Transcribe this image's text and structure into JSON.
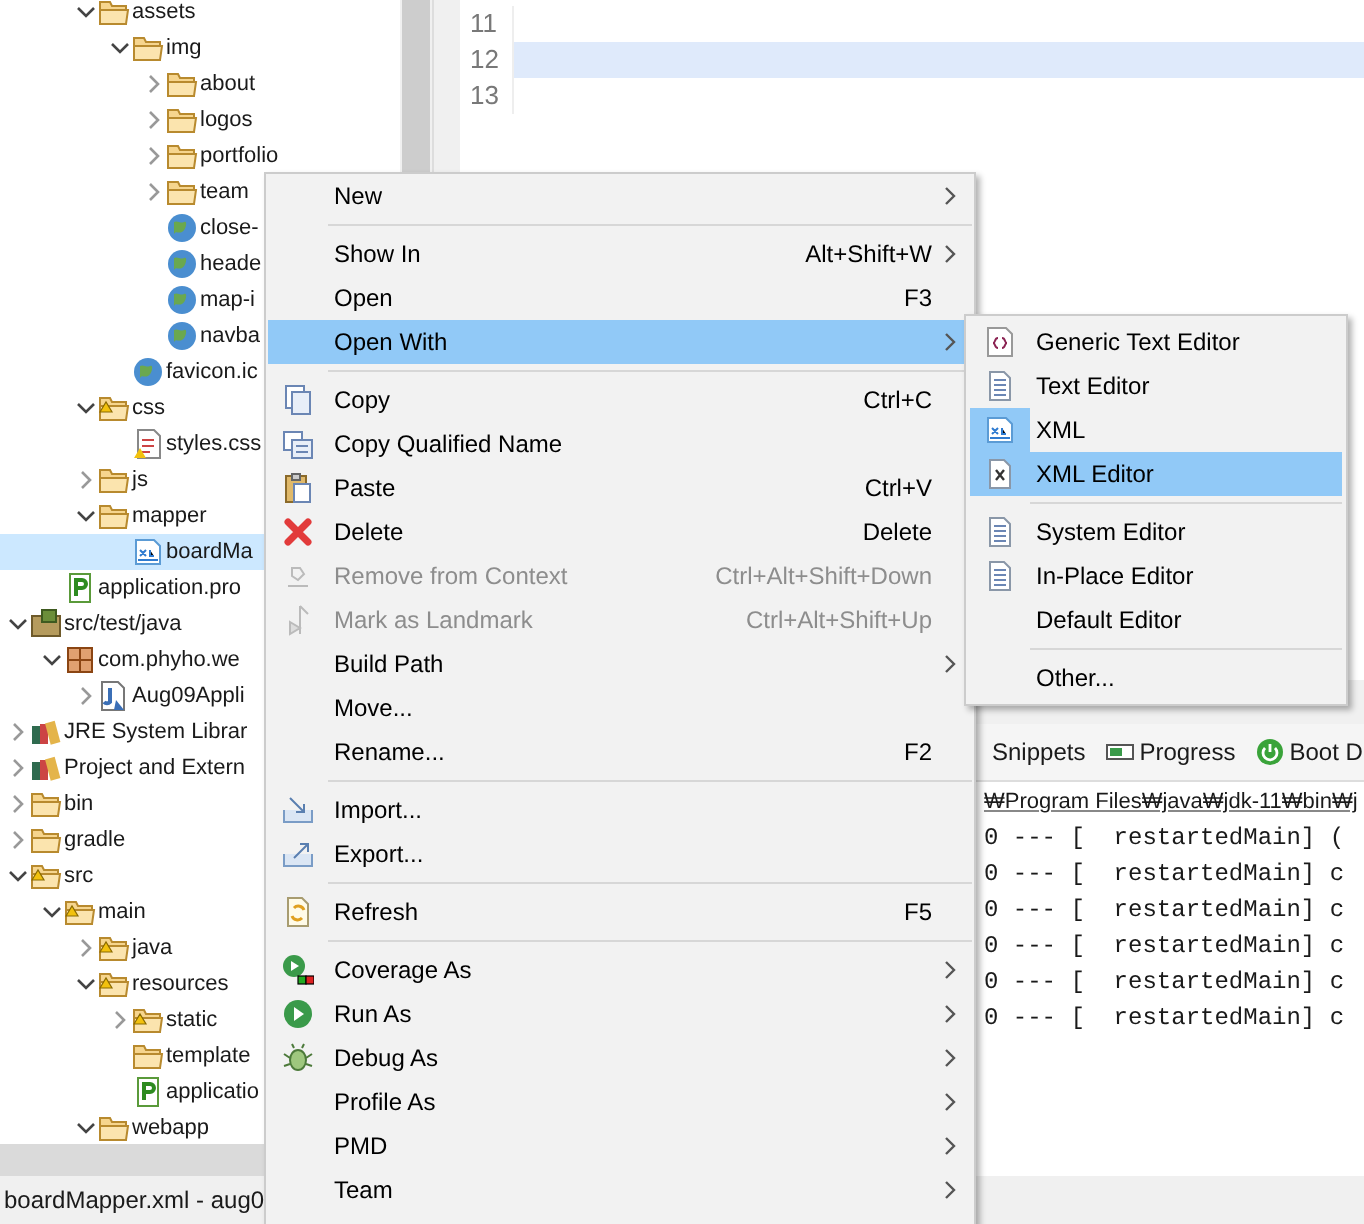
{
  "tree": {
    "items": [
      {
        "children": [
          {
            "children": [
              {
                "label": "assets",
                "kind": "folder",
                "expanded": true,
                "selected": false,
                "children": [
                  {
                    "label": "img",
                    "kind": "folder",
                    "expanded": true,
                    "selected": false,
                    "children": [
                      {
                        "label": "about",
                        "kind": "folder",
                        "expanded": false,
                        "selected": false
                      },
                      {
                        "label": "logos",
                        "kind": "folder",
                        "expanded": false,
                        "selected": false
                      },
                      {
                        "label": "portfolio",
                        "kind": "folder",
                        "expanded": false,
                        "selected": false
                      },
                      {
                        "label": "team",
                        "kind": "folder",
                        "expanded": false,
                        "selected": false
                      },
                      {
                        "label": "close-",
                        "kind": "globe",
                        "selected": false
                      },
                      {
                        "label": "heade",
                        "kind": "globe",
                        "selected": false
                      },
                      {
                        "label": "map-i",
                        "kind": "globe",
                        "selected": false
                      },
                      {
                        "label": "navba",
                        "kind": "globe",
                        "selected": false
                      }
                    ]
                  },
                  {
                    "label": "favicon.ic",
                    "kind": "globe",
                    "selected": false
                  }
                ]
              },
              {
                "label": "css",
                "kind": "folder-warn",
                "expanded": true,
                "selected": false,
                "children": [
                  {
                    "label": "styles.css",
                    "kind": "css",
                    "selected": false
                  }
                ]
              },
              {
                "label": "js",
                "kind": "folder",
                "expanded": false,
                "selected": false
              },
              {
                "label": "mapper",
                "kind": "folder",
                "expanded": true,
                "selected": false,
                "children": [
                  {
                    "label": "boardMa",
                    "kind": "xml",
                    "selected": true
                  }
                ]
              }
            ]
          },
          {
            "label": "application.pro",
            "kind": "props",
            "selected": false
          }
        ]
      },
      {
        "label": "src/test/java",
        "kind": "src-folder",
        "expanded": true,
        "selected": false,
        "children": [
          {
            "label": "com.phyho.we",
            "kind": "package",
            "expanded": true,
            "selected": false,
            "children": [
              {
                "label": "Aug09Appli",
                "kind": "java-test",
                "expanded": false,
                "selected": false
              }
            ]
          }
        ]
      },
      {
        "label": "JRE System Librar",
        "kind": "library",
        "expanded": false,
        "selected": false
      },
      {
        "label": "Project and Extern",
        "kind": "library",
        "expanded": false,
        "selected": false
      },
      {
        "label": "bin",
        "kind": "folder",
        "expanded": false,
        "selected": false
      },
      {
        "label": "gradle",
        "kind": "folder",
        "expanded": false,
        "selected": false
      },
      {
        "label": "src",
        "kind": "folder-warn",
        "expanded": true,
        "selected": false,
        "children": [
          {
            "label": "main",
            "kind": "folder-warn",
            "expanded": true,
            "selected": false,
            "children": [
              {
                "label": "java",
                "kind": "folder-warn",
                "expanded": false,
                "selected": false
              },
              {
                "label": "resources",
                "kind": "folder-warn",
                "expanded": true,
                "selected": false,
                "children": [
                  {
                    "label": "static",
                    "kind": "folder-warn",
                    "expanded": false,
                    "selected": false
                  },
                  {
                    "label": "template",
                    "kind": "folder",
                    "selected": false
                  },
                  {
                    "label": "applicatio",
                    "kind": "props",
                    "selected": false
                  }
                ]
              },
              {
                "label": "webapp",
                "kind": "folder",
                "expanded": true,
                "selected": false
              }
            ]
          }
        ]
      }
    ]
  },
  "editor": {
    "lines": [
      {
        "number": "11",
        "current": false
      },
      {
        "number": "12",
        "current": true
      },
      {
        "number": "13",
        "current": false
      }
    ]
  },
  "console": {
    "tabs": [
      {
        "label": "Snippets",
        "kind": "none"
      },
      {
        "label": "Progress",
        "kind": "progress"
      },
      {
        "label": "Boot D",
        "kind": "boot"
      }
    ],
    "path": "₩Program Files₩java₩jdk-11₩bin₩j",
    "lines": [
      "0 --- [  restartedMain] (",
      "0 --- [  restartedMain] c",
      "0 --- [  restartedMain] c",
      "0 --- [  restartedMain] c",
      "0 --- [  restartedMain] c",
      "0 --- [  restartedMain] c"
    ]
  },
  "status_bar": {
    "text": "boardMapper.xml - aug0"
  },
  "context_menu": {
    "items": [
      {
        "kind": "plain",
        "label": "New",
        "submenu": true,
        "disabled": false,
        "selected": false
      },
      {
        "kind": "separator"
      },
      {
        "kind": "plain",
        "label": "Show In",
        "shortcut": "Alt+Shift+W",
        "submenu": true,
        "disabled": false,
        "selected": false
      },
      {
        "kind": "plain",
        "label": "Open",
        "shortcut": "F3",
        "submenu": false,
        "disabled": false,
        "selected": false
      },
      {
        "kind": "plain",
        "label": "Open With",
        "submenu": true,
        "disabled": false,
        "selected": true
      },
      {
        "kind": "separator"
      },
      {
        "kind": "copy",
        "label": "Copy",
        "shortcut": "Ctrl+C",
        "submenu": false,
        "disabled": false,
        "selected": false
      },
      {
        "kind": "copy-name",
        "label": "Copy Qualified Name",
        "submenu": false,
        "disabled": false,
        "selected": false
      },
      {
        "kind": "paste",
        "label": "Paste",
        "shortcut": "Ctrl+V",
        "submenu": false,
        "disabled": false,
        "selected": false
      },
      {
        "kind": "delete",
        "label": "Delete",
        "shortcut": "Delete",
        "submenu": false,
        "disabled": false,
        "selected": false
      },
      {
        "kind": "remove",
        "label": "Remove from Context",
        "shortcut": "Ctrl+Alt+Shift+Down",
        "submenu": false,
        "disabled": true,
        "selected": false
      },
      {
        "kind": "landmark",
        "label": "Mark as Landmark",
        "shortcut": "Ctrl+Alt+Shift+Up",
        "submenu": false,
        "disabled": true,
        "selected": false
      },
      {
        "kind": "plain",
        "label": "Build Path",
        "submenu": true,
        "disabled": false,
        "selected": false
      },
      {
        "kind": "plain",
        "label": "Move...",
        "submenu": false,
        "disabled": false,
        "selected": false
      },
      {
        "kind": "plain",
        "label": "Rename...",
        "shortcut": "F2",
        "submenu": false,
        "disabled": false,
        "selected": false
      },
      {
        "kind": "separator"
      },
      {
        "kind": "import",
        "label": "Import...",
        "submenu": false,
        "disabled": false,
        "selected": false
      },
      {
        "kind": "export",
        "label": "Export...",
        "submenu": false,
        "disabled": false,
        "selected": false
      },
      {
        "kind": "separator"
      },
      {
        "kind": "refresh",
        "label": "Refresh",
        "shortcut": "F5",
        "submenu": false,
        "disabled": false,
        "selected": false
      },
      {
        "kind": "separator"
      },
      {
        "kind": "coverage",
        "label": "Coverage As",
        "submenu": true,
        "disabled": false,
        "selected": false
      },
      {
        "kind": "run",
        "label": "Run As",
        "submenu": true,
        "disabled": false,
        "selected": false
      },
      {
        "kind": "debug",
        "label": "Debug As",
        "submenu": true,
        "disabled": false,
        "selected": false
      },
      {
        "kind": "plain",
        "label": "Profile As",
        "submenu": true,
        "disabled": false,
        "selected": false
      },
      {
        "kind": "plain",
        "label": "PMD",
        "submenu": true,
        "disabled": false,
        "selected": false
      },
      {
        "kind": "plain",
        "label": "Team",
        "submenu": true,
        "disabled": false,
        "selected": false
      }
    ]
  },
  "submenu": {
    "items": [
      {
        "kind": "generic",
        "label": "Generic Text Editor",
        "selected": false,
        "current": false
      },
      {
        "kind": "text",
        "label": "Text Editor",
        "selected": false,
        "current": false
      },
      {
        "kind": "xml",
        "label": "XML",
        "selected": false,
        "current": true
      },
      {
        "kind": "xml-editor",
        "label": "XML Editor",
        "selected": true,
        "current": false
      },
      {
        "kind": "separator"
      },
      {
        "kind": "text",
        "label": "System Editor",
        "selected": false,
        "current": false
      },
      {
        "kind": "text",
        "label": "In-Place Editor",
        "selected": false,
        "current": false
      },
      {
        "kind": "plain",
        "label": "Default Editor",
        "selected": false,
        "current": false
      },
      {
        "kind": "separator"
      },
      {
        "kind": "plain",
        "label": "Other...",
        "selected": false,
        "current": false
      }
    ]
  }
}
